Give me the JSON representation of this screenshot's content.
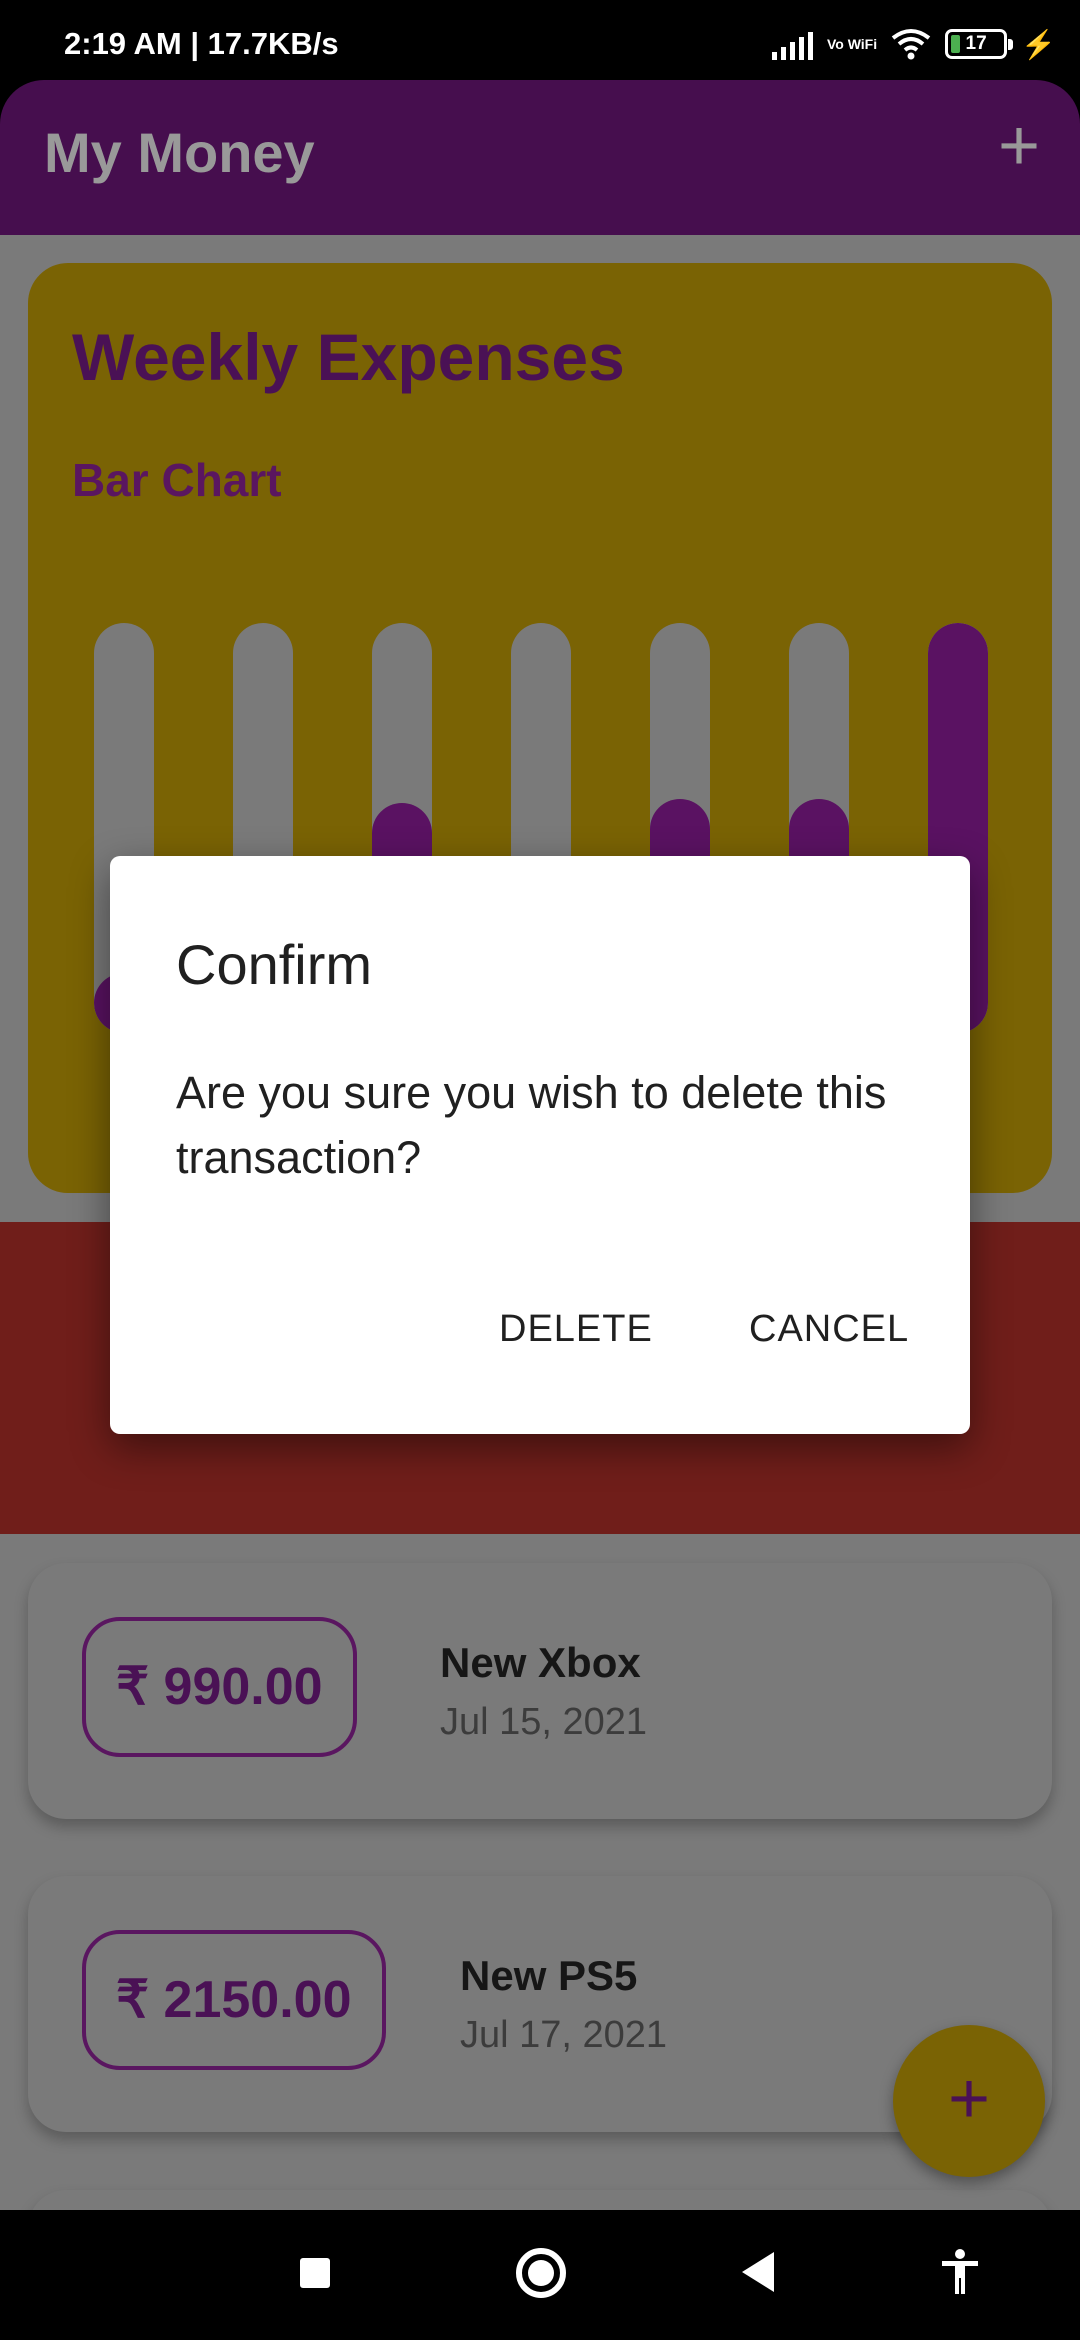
{
  "status_bar": {
    "time": "2:19 AM | 17.7KB/s",
    "battery_level": "17",
    "vowifi_label": "Vo WiFi"
  },
  "app_bar": {
    "title": "My Money",
    "add_icon": "plus-icon"
  },
  "chart_card": {
    "title": "Weekly Expenses",
    "subtitle": "Bar Chart",
    "colors": {
      "card": "#7a6304",
      "track": "#7a7a7a",
      "fill": "#5a1262"
    },
    "chart_data": {
      "type": "bar",
      "title": "Weekly Expenses",
      "subtitle": "Bar Chart",
      "categories": [],
      "values": [
        0.07,
        0.38,
        0.56,
        0.0,
        0.57,
        0.57,
        1.0
      ],
      "values_note_unit": "fraction of column filled"
    }
  },
  "transactions": [
    {
      "amount": "₹ 990.00",
      "title": "New Xbox",
      "date": "Jul 15, 2021"
    },
    {
      "amount": "₹ 2150.00",
      "title": "New PS5",
      "date": "Jul 17, 2021"
    }
  ],
  "fab": {
    "icon": "plus-icon"
  },
  "dialog": {
    "title": "Confirm",
    "message": "Are you sure you wish to delete this transaction?",
    "delete_label": "DELETE",
    "cancel_label": "CANCEL"
  },
  "nav_bar": {
    "icons": [
      "recents-square-icon",
      "home-circle-icon",
      "back-triangle-icon",
      "accessibility-icon"
    ]
  }
}
